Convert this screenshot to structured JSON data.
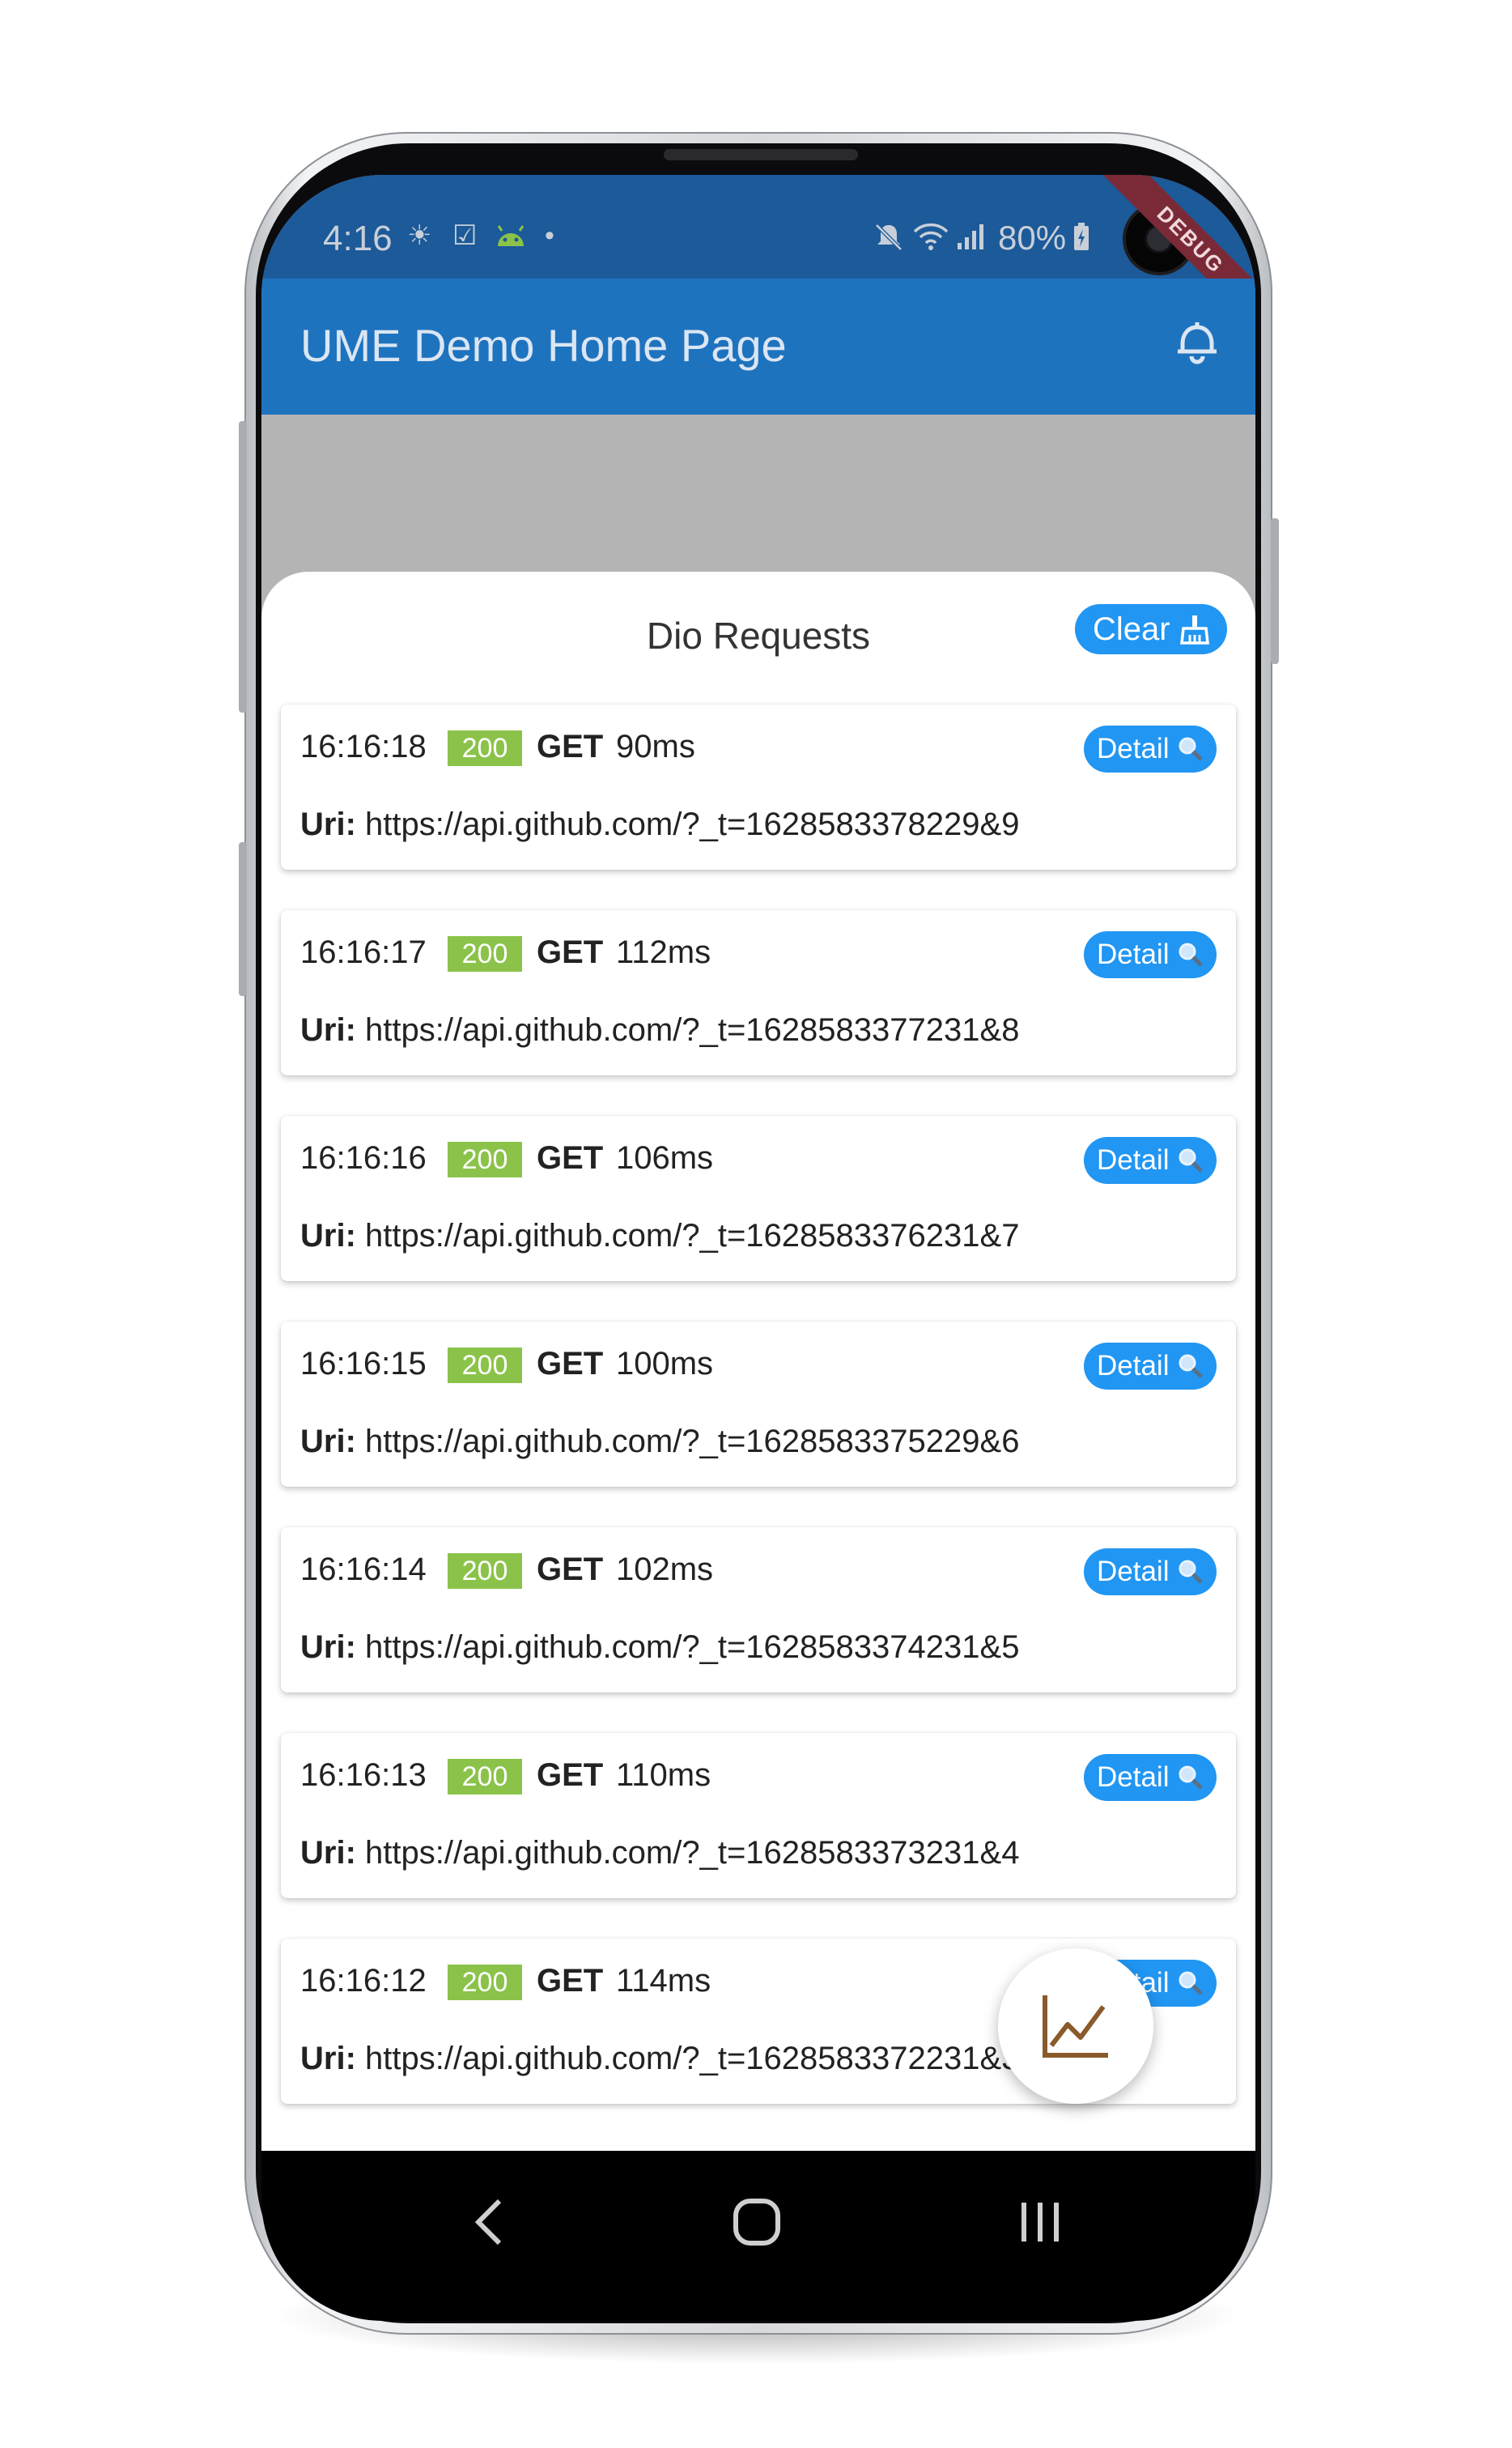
{
  "status_bar": {
    "time": "4:16",
    "battery": "80%",
    "debug_banner": "DEBUG"
  },
  "app_bar": {
    "title": "UME Demo Home Page",
    "action_icon": "bell-icon"
  },
  "sheet": {
    "title": "Dio Requests",
    "clear_label": "Clear",
    "clear_icon": "broom-icon"
  },
  "requests": [
    {
      "time": "16:16:18",
      "status": "200",
      "method": "GET",
      "duration": "90ms",
      "detail_label": "Detail",
      "uri_label": "Uri:",
      "uri": "https://api.github.com/?_t=1628583378229&9"
    },
    {
      "time": "16:16:17",
      "status": "200",
      "method": "GET",
      "duration": "112ms",
      "detail_label": "Detail",
      "uri_label": "Uri:",
      "uri": "https://api.github.com/?_t=1628583377231&8"
    },
    {
      "time": "16:16:16",
      "status": "200",
      "method": "GET",
      "duration": "106ms",
      "detail_label": "Detail",
      "uri_label": "Uri:",
      "uri": "https://api.github.com/?_t=1628583376231&7"
    },
    {
      "time": "16:16:15",
      "status": "200",
      "method": "GET",
      "duration": "100ms",
      "detail_label": "Detail",
      "uri_label": "Uri:",
      "uri": "https://api.github.com/?_t=1628583375229&6"
    },
    {
      "time": "16:16:14",
      "status": "200",
      "method": "GET",
      "duration": "102ms",
      "detail_label": "Detail",
      "uri_label": "Uri:",
      "uri": "https://api.github.com/?_t=1628583374231&5"
    },
    {
      "time": "16:16:13",
      "status": "200",
      "method": "GET",
      "duration": "110ms",
      "detail_label": "Detail",
      "uri_label": "Uri:",
      "uri": "https://api.github.com/?_t=1628583373231&4"
    },
    {
      "time": "16:16:12",
      "status": "200",
      "method": "GET",
      "duration": "114ms",
      "detail_label": "Detail",
      "uri_label": "Uri:",
      "uri": "https://api.github.com/?_t=1628583372231&3"
    }
  ],
  "colors": {
    "app_bar": "#1e73bf",
    "status_bar": "#1c5a99",
    "accent_button": "#2196f3",
    "status_ok": "#8bc34a"
  }
}
